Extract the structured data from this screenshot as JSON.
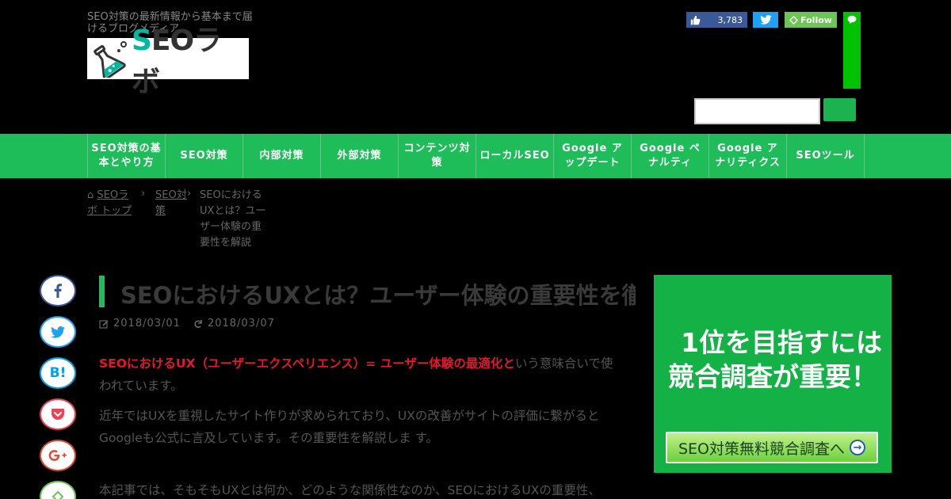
{
  "header": {
    "tagline": "SEO対策の最新情報から基本まで届けるブログメディア",
    "logo_text_s": "S",
    "logo_text_rest": "EOラボ"
  },
  "social_top": {
    "fb_count": "3,783",
    "feedly_label": "Follow"
  },
  "search": {
    "placeholder": ""
  },
  "nav": {
    "items": [
      "SEO対策の基本とやり方",
      "SEO対策",
      "内部対策",
      "外部対策",
      "コンテンツ対策",
      "ローカルSEO",
      "Google アップデート",
      "Google ペナルティ",
      "Google アナリティクス",
      "SEOツール"
    ]
  },
  "breadcrumb": {
    "home": "SEOラボ トップ",
    "category": "SEO対策",
    "current": "SEOにおけるUXとは？ユーザー体験の重要性を解説"
  },
  "share": {
    "hatena": "B!"
  },
  "post": {
    "title": "SEOにおけるUXとは？ユーザー体験の重要性を徹底解説",
    "published": "2018/03/01",
    "updated": "2018/03/07",
    "p1_em": "SEOにおけるUX（ユーザーエクスペリエンス）= ユーザー体験の最適化と",
    "p1_rest": "いう意味合いで使われています。",
    "p2": "近年ではUXを重視したサイト作りが求められており、UXの改善がサイトの評価に繋がるとGoogleも公式に言及しています。その重要性を解説しま す。",
    "p3": "本記事では、そもそもUXとは何か、どのような関係性なのか、SEOにおけるUXの重要性、Googleが公開しているガイドラインから読み解く"
  },
  "ad": {
    "line1": "1位を目指すには",
    "line2": "競合調査が重要！",
    "cta": "SEO対策無料競合調査へ"
  },
  "colors": {
    "brand_green": "#1ebd5a",
    "emphasis_red": "#e0192e",
    "logo_teal": "#00b8a0"
  },
  "icons": [
    "flask-icon",
    "thumbs-up-icon",
    "twitter-icon",
    "feedly-icon",
    "line-icon",
    "home-icon",
    "chevron-right-icon",
    "pencil-icon",
    "refresh-icon",
    "facebook-icon",
    "hatena-icon",
    "pocket-icon",
    "google-plus-icon",
    "arrow-right-icon"
  ]
}
